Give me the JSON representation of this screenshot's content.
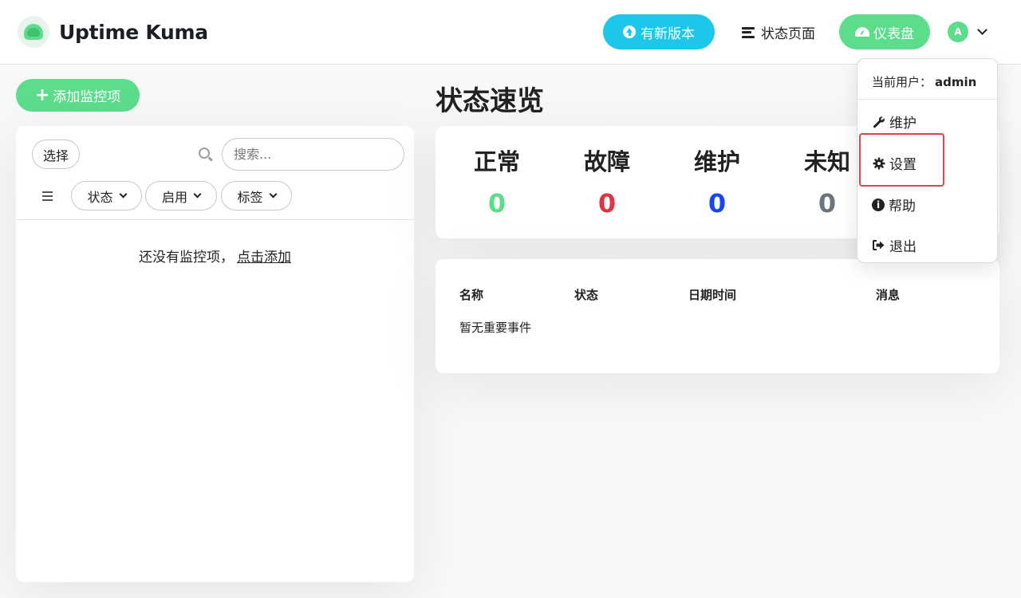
{
  "app": {
    "title": "Uptime Kuma"
  },
  "header": {
    "update_label": "有新版本",
    "status_page_label": "状态页面",
    "dashboard_label": "仪表盘",
    "avatar_initial": "A"
  },
  "sidebar": {
    "add_monitor_label": "添加监控项",
    "select_label": "选择",
    "search": {
      "placeholder": "搜索...",
      "value": ""
    },
    "filters": [
      {
        "label": "状态"
      },
      {
        "label": "启用"
      },
      {
        "label": "标签"
      }
    ],
    "empty_text": "还没有监控项，",
    "empty_link": "点击添加"
  },
  "main": {
    "title": "状态速览",
    "stats": [
      {
        "label": "正常",
        "value": "0",
        "color": "#5cdd8b"
      },
      {
        "label": "故障",
        "value": "0",
        "color": "#dc3545"
      },
      {
        "label": "维护",
        "value": "0",
        "color": "#1747f5"
      },
      {
        "label": "未知",
        "value": "0",
        "color": "#6c757d"
      }
    ],
    "events": {
      "columns": [
        "名称",
        "状态",
        "日期时间",
        "消息"
      ],
      "empty_text": "暂无重要事件"
    }
  },
  "user_menu": {
    "current_user_label": "当前用户：",
    "username": "admin",
    "items": [
      {
        "label": "维护",
        "icon": "wrench-icon"
      },
      {
        "label": "设置",
        "icon": "gear-icon"
      },
      {
        "label": "帮助",
        "icon": "info-icon"
      },
      {
        "label": "退出",
        "icon": "logout-icon"
      }
    ],
    "highlight_color": "#e0444c"
  }
}
